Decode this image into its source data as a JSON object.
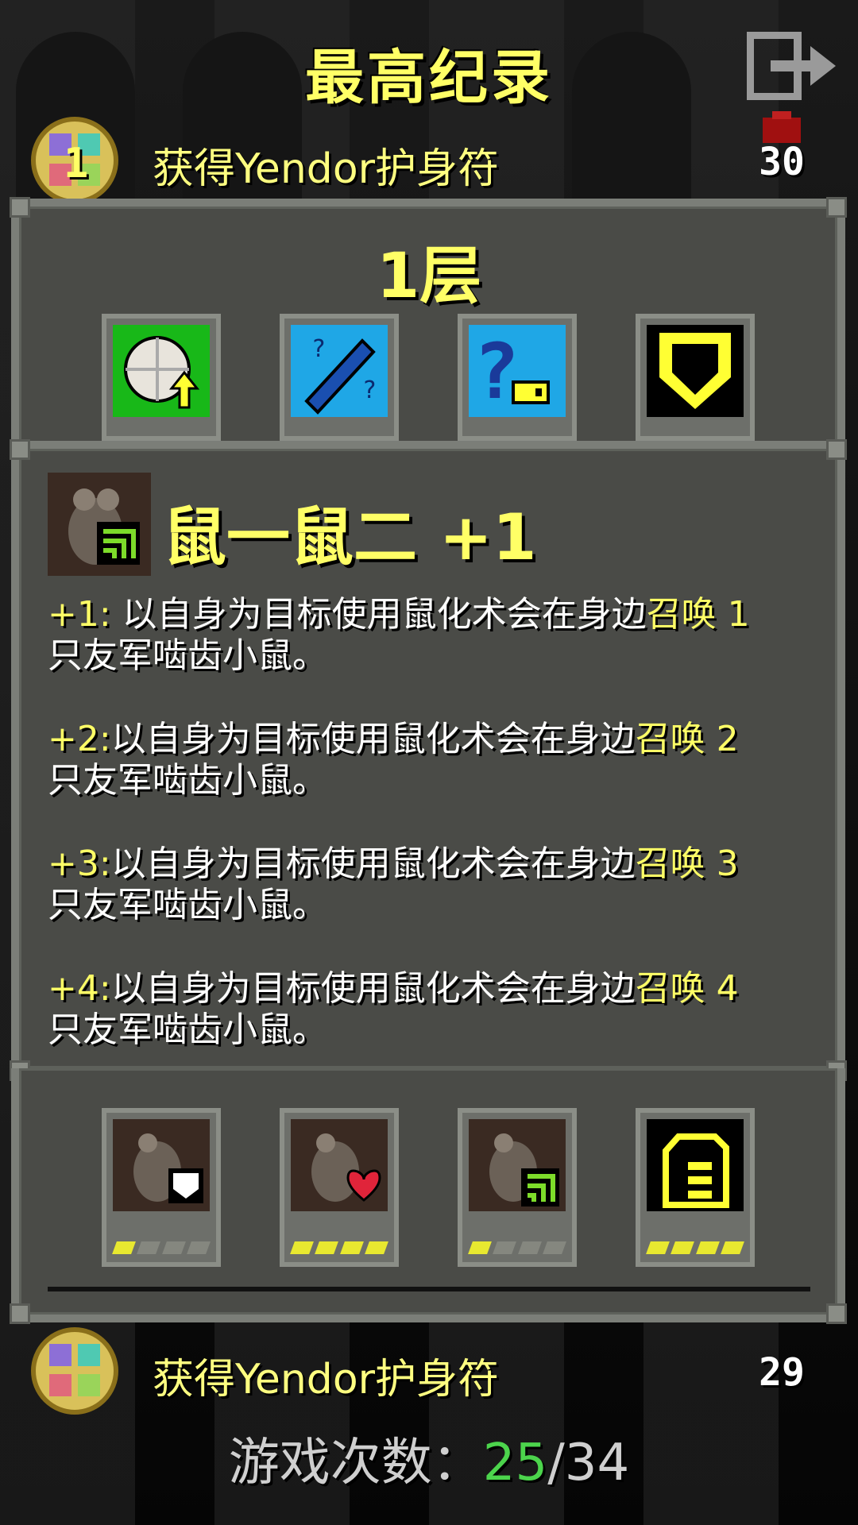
{
  "header": {
    "title": "最高纪录",
    "exit_icon": "exit-icon"
  },
  "records": [
    {
      "rank": "1",
      "text": "获得Yendor护身符",
      "depth": "30",
      "icon": "yendor-amulet-icon"
    },
    {
      "rank": "",
      "text": "获得Yendor护身符",
      "depth": "29",
      "icon": "yendor-amulet-icon"
    }
  ],
  "panel": {
    "floor_label": "1层",
    "equipment": [
      {
        "name": "white-ring-icon",
        "bg": "#18b818"
      },
      {
        "name": "blue-wand-icon",
        "bg": "#1fa7e6"
      },
      {
        "name": "unknown-key-icon",
        "bg": "#1fa7e6"
      },
      {
        "name": "yellow-shield-icon",
        "bg": "#000000"
      }
    ],
    "talent": {
      "title": "鼠一鼠二 +1",
      "lines": [
        {
          "prefix": "+1:",
          "body": " 以自身为目标使用鼠化术会在身边",
          "hl": "召唤",
          "num": " 1",
          "tail": "只友军啮齿小鼠。"
        },
        {
          "prefix": "+2:",
          "body": "以自身为目标使用鼠化术会在身边",
          "hl": "召唤",
          "num": " 2",
          "tail": "只友军啮齿小鼠。"
        },
        {
          "prefix": "+3:",
          "body": "以自身为目标使用鼠化术会在身边",
          "hl": "召唤",
          "num": " 3",
          "tail": "只友军啮齿小鼠。"
        },
        {
          "prefix": "+4:",
          "body": "以自身为目标使用鼠化术会在身边",
          "hl": "召唤",
          "num": " 4",
          "tail": "只友军啮齿小鼠。"
        }
      ]
    },
    "talent_slots": [
      {
        "name": "rat-white-talent-icon",
        "level": 1
      },
      {
        "name": "rat-heart-talent-icon",
        "level": 4
      },
      {
        "name": "rat-green-talent-icon",
        "level": 1
      },
      {
        "name": "yellow-scroll-talent-icon",
        "level": 4
      }
    ]
  },
  "footer": {
    "label": "游戏次数：",
    "current": "25",
    "total": "/34"
  }
}
